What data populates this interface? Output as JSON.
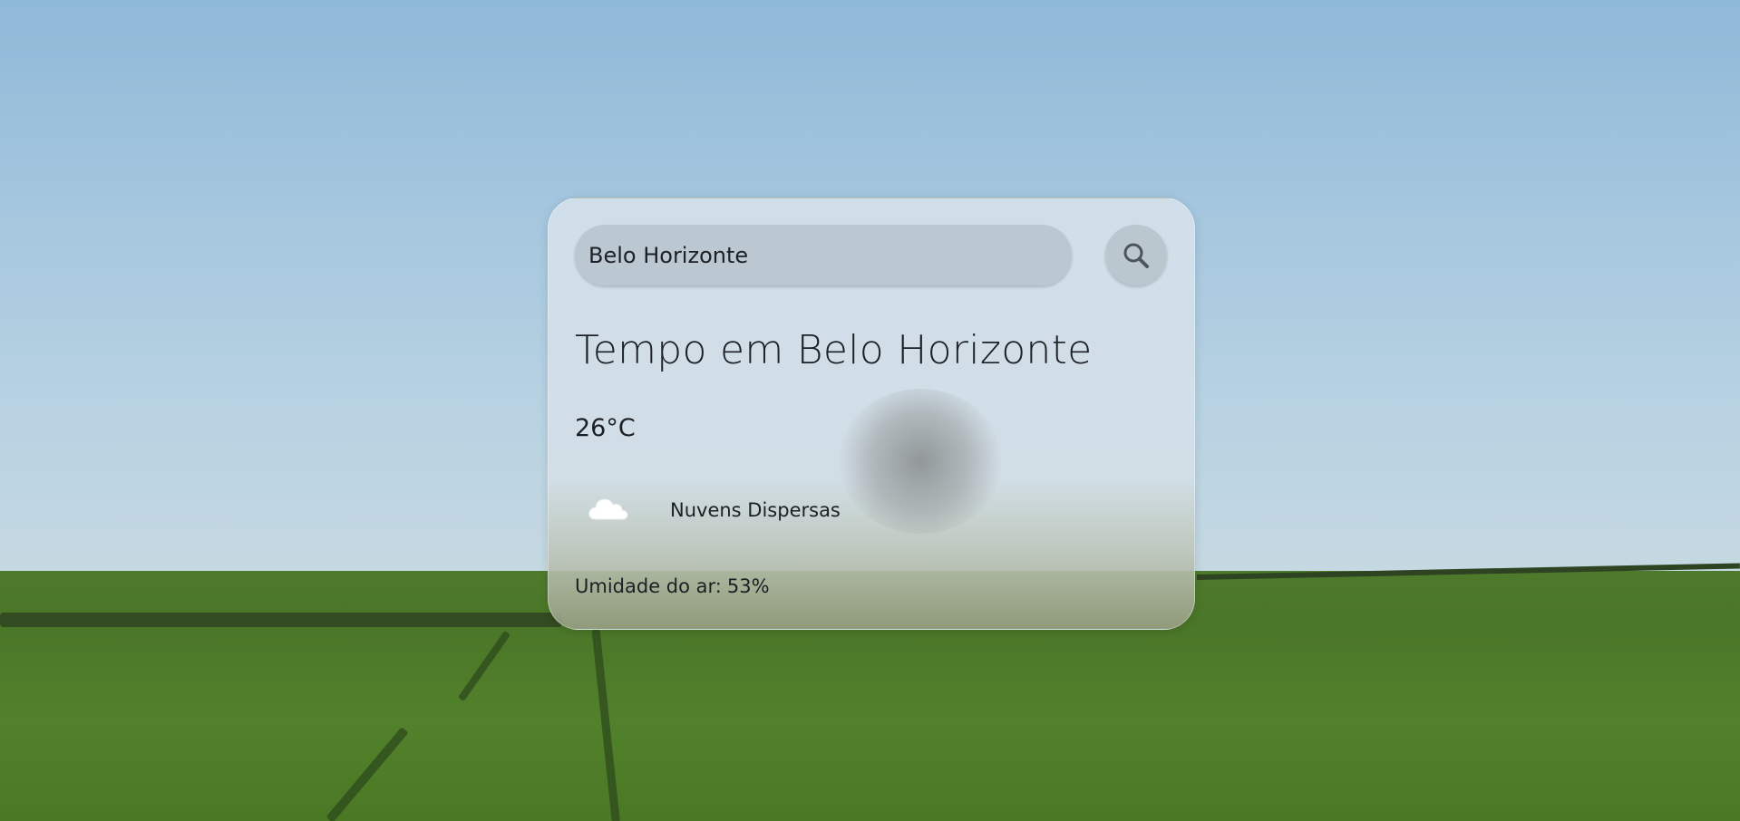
{
  "search": {
    "value": "Belo Horizonte"
  },
  "weather": {
    "title": "Tempo em Belo Horizonte",
    "temperature": "26°C",
    "icon": "cloud-icon",
    "description": "Nuvens Dispersas",
    "humidity_label": "Umidade do ar:",
    "humidity_value": "53%"
  },
  "colors": {
    "sky": "#a4c6de",
    "field": "#4f7a2c",
    "text": "#1c2024"
  }
}
